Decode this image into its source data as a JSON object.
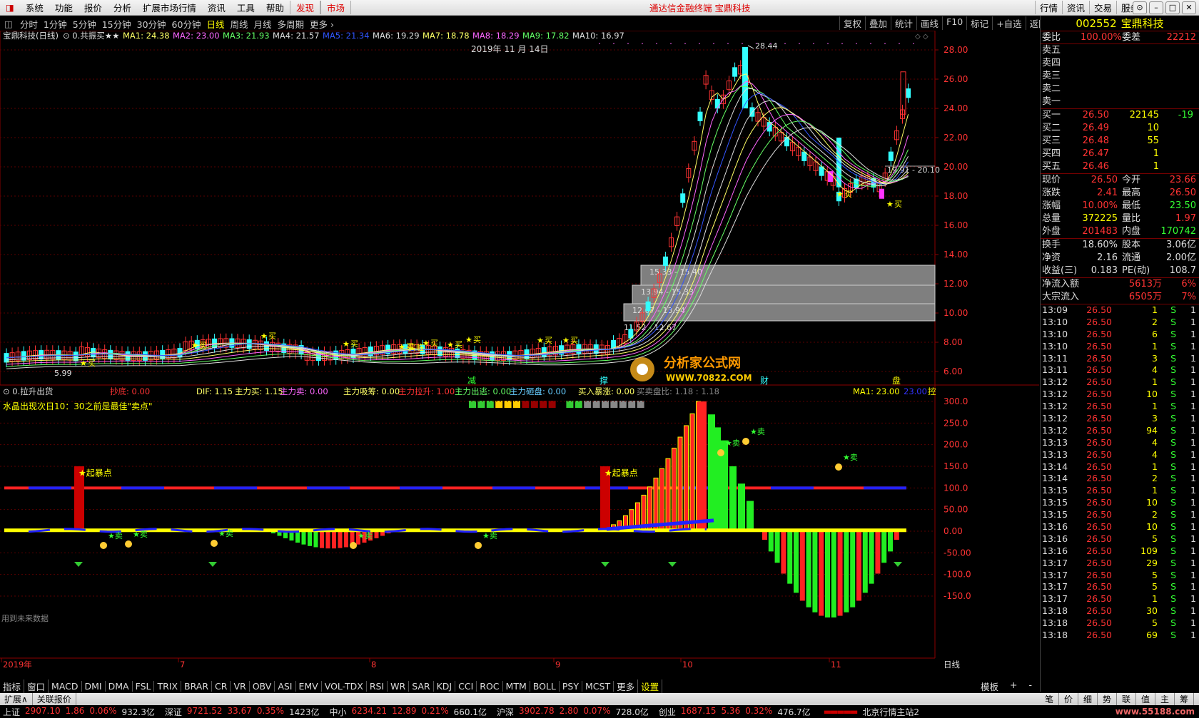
{
  "menu": {
    "items": [
      "系统",
      "功能",
      "报价",
      "分析",
      "扩展市场行情",
      "资讯",
      "工具",
      "帮助"
    ],
    "hl": [
      "发现",
      "市场"
    ],
    "title": "通达信金融终端 宝鼎科技",
    "right": [
      "行情",
      "资讯",
      "交易",
      "服务"
    ]
  },
  "toolbar": {
    "periods": [
      "分时",
      "1分钟",
      "5分钟",
      "15分钟",
      "30分钟",
      "60分钟",
      "日线",
      "周线",
      "月线",
      "多周期",
      "更多"
    ],
    "active": "日线",
    "right": [
      "复权",
      "叠加",
      "统计",
      "画线",
      "F10",
      "标记",
      "+自选",
      "返回"
    ]
  },
  "main_legend": {
    "stock": "宝鼎科技(日线)",
    "formula": "0.共振买★★",
    "ma": [
      {
        "t": "MA1: 24.38",
        "c": "#ffff66"
      },
      {
        "t": "MA2: 23.00",
        "c": "#ff66ff"
      },
      {
        "t": "MA3: 21.93",
        "c": "#66ff66"
      },
      {
        "t": "MA4: 21.57",
        "c": "#dddddd"
      },
      {
        "t": "MA5: 21.34",
        "c": "#3355ff"
      },
      {
        "t": "MA6: 19.29",
        "c": "#dddddd"
      },
      {
        "t": "MA7: 18.78",
        "c": "#ffff66"
      },
      {
        "t": "MA8: 18.29",
        "c": "#ff66ff"
      },
      {
        "t": "MA9: 17.82",
        "c": "#66ff66"
      },
      {
        "t": "MA10: 16.97",
        "c": "#dddddd"
      }
    ],
    "date": "2019年 11 月 14日",
    "high_label": "28.44",
    "low_label": "5.99",
    "range_label": "19.91 - 20.10"
  },
  "price_axis": [
    "28.00",
    "26.00",
    "24.00",
    "22.00",
    "20.00",
    "18.00",
    "16.00",
    "14.00",
    "12.00",
    "10.00",
    "8.00",
    "6.00"
  ],
  "zones": [
    {
      "label": "15.33 - 15.40"
    },
    {
      "label": "13.94 - 15.33"
    },
    {
      "label": "12.67 - 13.94"
    },
    {
      "label": "11.52 - 12.67"
    }
  ],
  "markers": {
    "buy": "买",
    "buy_ci": "买临",
    "sell": "卖",
    "dawn": "起暴点",
    "jian": "减",
    "hold": "撑",
    "cai": "财",
    "pan": "盘"
  },
  "watermark": {
    "name": "分析家公式网",
    "url": "WWW.70822.COM"
  },
  "sub_legend": {
    "title": "0.拉升出货",
    "items": [
      {
        "t": "抄底: 0.00",
        "c": "#ff3333"
      },
      {
        "t": "DIF: 1.15",
        "c": "#ffff66"
      },
      {
        "t": "主力买: 1.15",
        "c": "#ffff66"
      },
      {
        "t": "主力卖: 0.00",
        "c": "#ff66ff"
      },
      {
        "t": "主力吸筹: 0.00",
        "c": "#ffff66"
      },
      {
        "t": "主力拉升: 1.00",
        "c": "#ff3333"
      },
      {
        "t": "主力出逃: 0.00",
        "c": "#66ff66"
      },
      {
        "t": "主力砸盘: 0.00",
        "c": "#66ccff"
      },
      {
        "t": "买入暴涨: 0.00",
        "c": "#ffff66"
      },
      {
        "t": "买卖盘比: 1.18 : 1.18",
        "c": "#888888"
      }
    ],
    "ma1": "MA1: 23.00",
    "ma2": "23.00",
    "ctrl": "控",
    "note": "水晶出现次日10：30之前是最佳\"卖点\"",
    "future": "用到未来数据"
  },
  "sub_axis": [
    "300.0",
    "250.0",
    "200.0",
    "150.0",
    "100.0",
    "50.00",
    "0.00",
    "-50.00",
    "-100.0",
    "-150.0"
  ],
  "time_axis": [
    {
      "t": "2019年"
    },
    {
      "t": "7"
    },
    {
      "t": "8"
    },
    {
      "t": "9"
    },
    {
      "t": "10"
    },
    {
      "t": "11"
    }
  ],
  "period_label": "日线",
  "indicator_tabs": [
    "指标",
    "窗口",
    "MACD",
    "DMI",
    "DMA",
    "FSL",
    "TRIX",
    "BRAR",
    "CR",
    "VR",
    "OBV",
    "ASI",
    "EMV",
    "VOL-TDX",
    "RSI",
    "WR",
    "SAR",
    "KDJ",
    "CCI",
    "ROC",
    "MTM",
    "BOLL",
    "PSY",
    "MCST",
    "更多",
    "设置"
  ],
  "tab_right": [
    "模板",
    "+",
    "-"
  ],
  "bottom_tabs": [
    "扩展∧",
    "关联报价"
  ],
  "quote": {
    "code": "002552",
    "name": "宝鼎科技",
    "wb": [
      "委比",
      "100.00%",
      "委差",
      "22212"
    ],
    "sells": [
      "卖五",
      "卖四",
      "卖三",
      "卖二",
      "卖一"
    ],
    "buys": [
      [
        "买一",
        "26.50",
        "22145",
        "-19"
      ],
      [
        "买二",
        "26.49",
        "10",
        ""
      ],
      [
        "买三",
        "26.48",
        "55",
        ""
      ],
      [
        "买四",
        "26.47",
        "1",
        ""
      ],
      [
        "买五",
        "26.46",
        "1",
        ""
      ]
    ],
    "stats": [
      [
        "现价",
        "26.50",
        "今开",
        "23.66"
      ],
      [
        "涨跌",
        "2.41",
        "最高",
        "26.50"
      ],
      [
        "涨幅",
        "10.00%",
        "最低",
        "23.50"
      ],
      [
        "总量",
        "372225",
        "量比",
        "1.97"
      ],
      [
        "外盘",
        "201483",
        "内盘",
        "170742"
      ]
    ],
    "stats2": [
      [
        "换手",
        "18.60%",
        "股本",
        "3.06亿"
      ],
      [
        "净资",
        "2.16",
        "流通",
        "2.00亿"
      ],
      [
        "收益(三)",
        "0.183",
        "PE(动)",
        "108.7"
      ]
    ],
    "flows": [
      [
        "净流入额",
        "5613万",
        "6%"
      ],
      [
        "大宗流入",
        "6505万",
        "7%"
      ]
    ],
    "ticks": [
      [
        "13:09",
        "26.50",
        "1",
        "S",
        "1"
      ],
      [
        "13:10",
        "26.50",
        "2",
        "S",
        "1"
      ],
      [
        "13:10",
        "26.50",
        "6",
        "S",
        "1"
      ],
      [
        "13:10",
        "26.50",
        "1",
        "S",
        "1"
      ],
      [
        "13:11",
        "26.50",
        "3",
        "S",
        "1"
      ],
      [
        "13:11",
        "26.50",
        "4",
        "S",
        "1"
      ],
      [
        "13:12",
        "26.50",
        "1",
        "S",
        "1"
      ],
      [
        "13:12",
        "26.50",
        "10",
        "S",
        "1"
      ],
      [
        "13:12",
        "26.50",
        "1",
        "S",
        "1"
      ],
      [
        "13:12",
        "26.50",
        "3",
        "S",
        "1"
      ],
      [
        "13:12",
        "26.50",
        "94",
        "S",
        "1"
      ],
      [
        "13:13",
        "26.50",
        "4",
        "S",
        "1"
      ],
      [
        "13:13",
        "26.50",
        "4",
        "S",
        "1"
      ],
      [
        "13:14",
        "26.50",
        "1",
        "S",
        "1"
      ],
      [
        "13:14",
        "26.50",
        "2",
        "S",
        "1"
      ],
      [
        "13:15",
        "26.50",
        "1",
        "S",
        "1"
      ],
      [
        "13:15",
        "26.50",
        "10",
        "S",
        "1"
      ],
      [
        "13:15",
        "26.50",
        "2",
        "S",
        "1"
      ],
      [
        "13:16",
        "26.50",
        "10",
        "S",
        "1"
      ],
      [
        "13:16",
        "26.50",
        "5",
        "S",
        "1"
      ],
      [
        "13:16",
        "26.50",
        "109",
        "S",
        "1"
      ],
      [
        "13:17",
        "26.50",
        "29",
        "S",
        "1"
      ],
      [
        "13:17",
        "26.50",
        "5",
        "S",
        "1"
      ],
      [
        "13:17",
        "26.50",
        "5",
        "S",
        "1"
      ],
      [
        "13:17",
        "26.50",
        "1",
        "S",
        "1"
      ],
      [
        "13:18",
        "26.50",
        "30",
        "S",
        "1"
      ],
      [
        "13:18",
        "26.50",
        "5",
        "S",
        "1"
      ],
      [
        "13:18",
        "26.50",
        "69",
        "S",
        "1"
      ]
    ],
    "bottom_tabs": [
      "笔",
      "价",
      "细",
      "势",
      "联",
      "值",
      "主",
      "筹"
    ]
  },
  "index_bar": [
    {
      "name": "上证",
      "v": "2907.10",
      "d": "1.86",
      "p": "0.06%",
      "a": "932.3亿"
    },
    {
      "name": "深证",
      "v": "9721.52",
      "d": "33.67",
      "p": "0.35%",
      "a": "1423亿"
    },
    {
      "name": "中小",
      "v": "6234.21",
      "d": "12.89",
      "p": "0.21%",
      "a": "660.1亿"
    },
    {
      "name": "沪深",
      "v": "3902.78",
      "d": "2.80",
      "p": "0.07%",
      "a": "728.0亿"
    },
    {
      "name": "创业",
      "v": "1687.15",
      "d": "5.36",
      "p": "0.32%",
      "a": "476.7亿"
    }
  ],
  "server": "北京行情主站2",
  "site": "www.55188.com",
  "colors": {
    "up": "#ff3333",
    "down": "#33ffff",
    "grid": "#7a0000"
  }
}
